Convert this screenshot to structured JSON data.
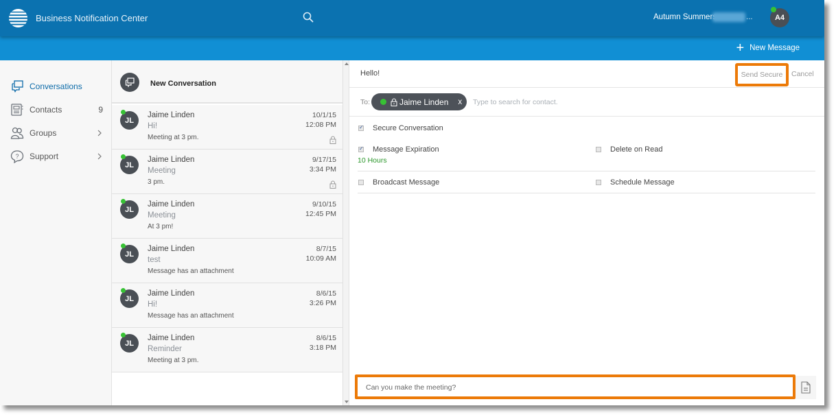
{
  "app": {
    "title": "Business Notification Center",
    "brand_color": "#0b72b0",
    "subbar_color": "#118fd4",
    "highlight_color": "#ec7a08"
  },
  "header": {
    "search_icon": "search-icon",
    "user_name": "Autumn Summers",
    "user_suffix": "...",
    "avatar_initials": "A4",
    "presence": "online"
  },
  "toolbar": {
    "new_message_label": "New Message",
    "new_message_icon": "plus-icon"
  },
  "sidebar": {
    "items": [
      {
        "label": "Conversations",
        "icon": "conversations-icon",
        "active": true,
        "count": null,
        "chevron": false
      },
      {
        "label": "Contacts",
        "icon": "contacts-icon",
        "active": false,
        "count": "9",
        "chevron": false
      },
      {
        "label": "Groups",
        "icon": "groups-icon",
        "active": false,
        "count": null,
        "chevron": true
      },
      {
        "label": "Support",
        "icon": "support-icon",
        "active": false,
        "count": null,
        "chevron": true
      }
    ]
  },
  "conversations": {
    "new_label": "New Conversation",
    "items": [
      {
        "initials": "JL",
        "name": "Jaime Linden",
        "subject": "Hi!",
        "preview": "Meeting at 3 pm.",
        "date": "10/1/15",
        "time": "12:08 PM",
        "locked": true
      },
      {
        "initials": "JL",
        "name": "Jaime Linden",
        "subject": "Meeting",
        "preview": "3 pm.",
        "date": "9/17/15",
        "time": "3:34 PM",
        "locked": true
      },
      {
        "initials": "JL",
        "name": "Jaime Linden",
        "subject": "Meeting",
        "preview": "At 3 pm!",
        "date": "9/10/15",
        "time": "12:45 PM",
        "locked": false
      },
      {
        "initials": "JL",
        "name": "Jaime Linden",
        "subject": "test",
        "preview": "Message has an attachment",
        "date": "8/7/15",
        "time": "10:09 AM",
        "locked": false
      },
      {
        "initials": "JL",
        "name": "Jaime Linden",
        "subject": "Hi!",
        "preview": "Message has an attachment",
        "date": "8/6/15",
        "time": "3:26 PM",
        "locked": false
      },
      {
        "initials": "JL",
        "name": "Jaime Linden",
        "subject": "Reminder",
        "preview": "Meeting at 3 pm.",
        "date": "8/6/15",
        "time": "3:18 PM",
        "locked": false
      }
    ]
  },
  "compose": {
    "subject": "Hello!",
    "send_secure_label": "Send Secure",
    "cancel_label": "Cancel",
    "to_label": "To:",
    "recipient": {
      "name": "Jaime Linden",
      "remove": "x"
    },
    "to_placeholder": "Type to search for contact.",
    "options": {
      "secure_conversation": {
        "label": "Secure Conversation",
        "checked": true
      },
      "message_expiration": {
        "label": "Message Expiration",
        "checked": true,
        "value": "10 Hours"
      },
      "delete_on_read": {
        "label": "Delete on Read",
        "checked": false
      },
      "broadcast_message": {
        "label": "Broadcast Message",
        "checked": false
      },
      "schedule_message": {
        "label": "Schedule Message",
        "checked": false
      }
    },
    "message_text": "Can you make the meeting?",
    "attach_icon": "document-icon"
  }
}
